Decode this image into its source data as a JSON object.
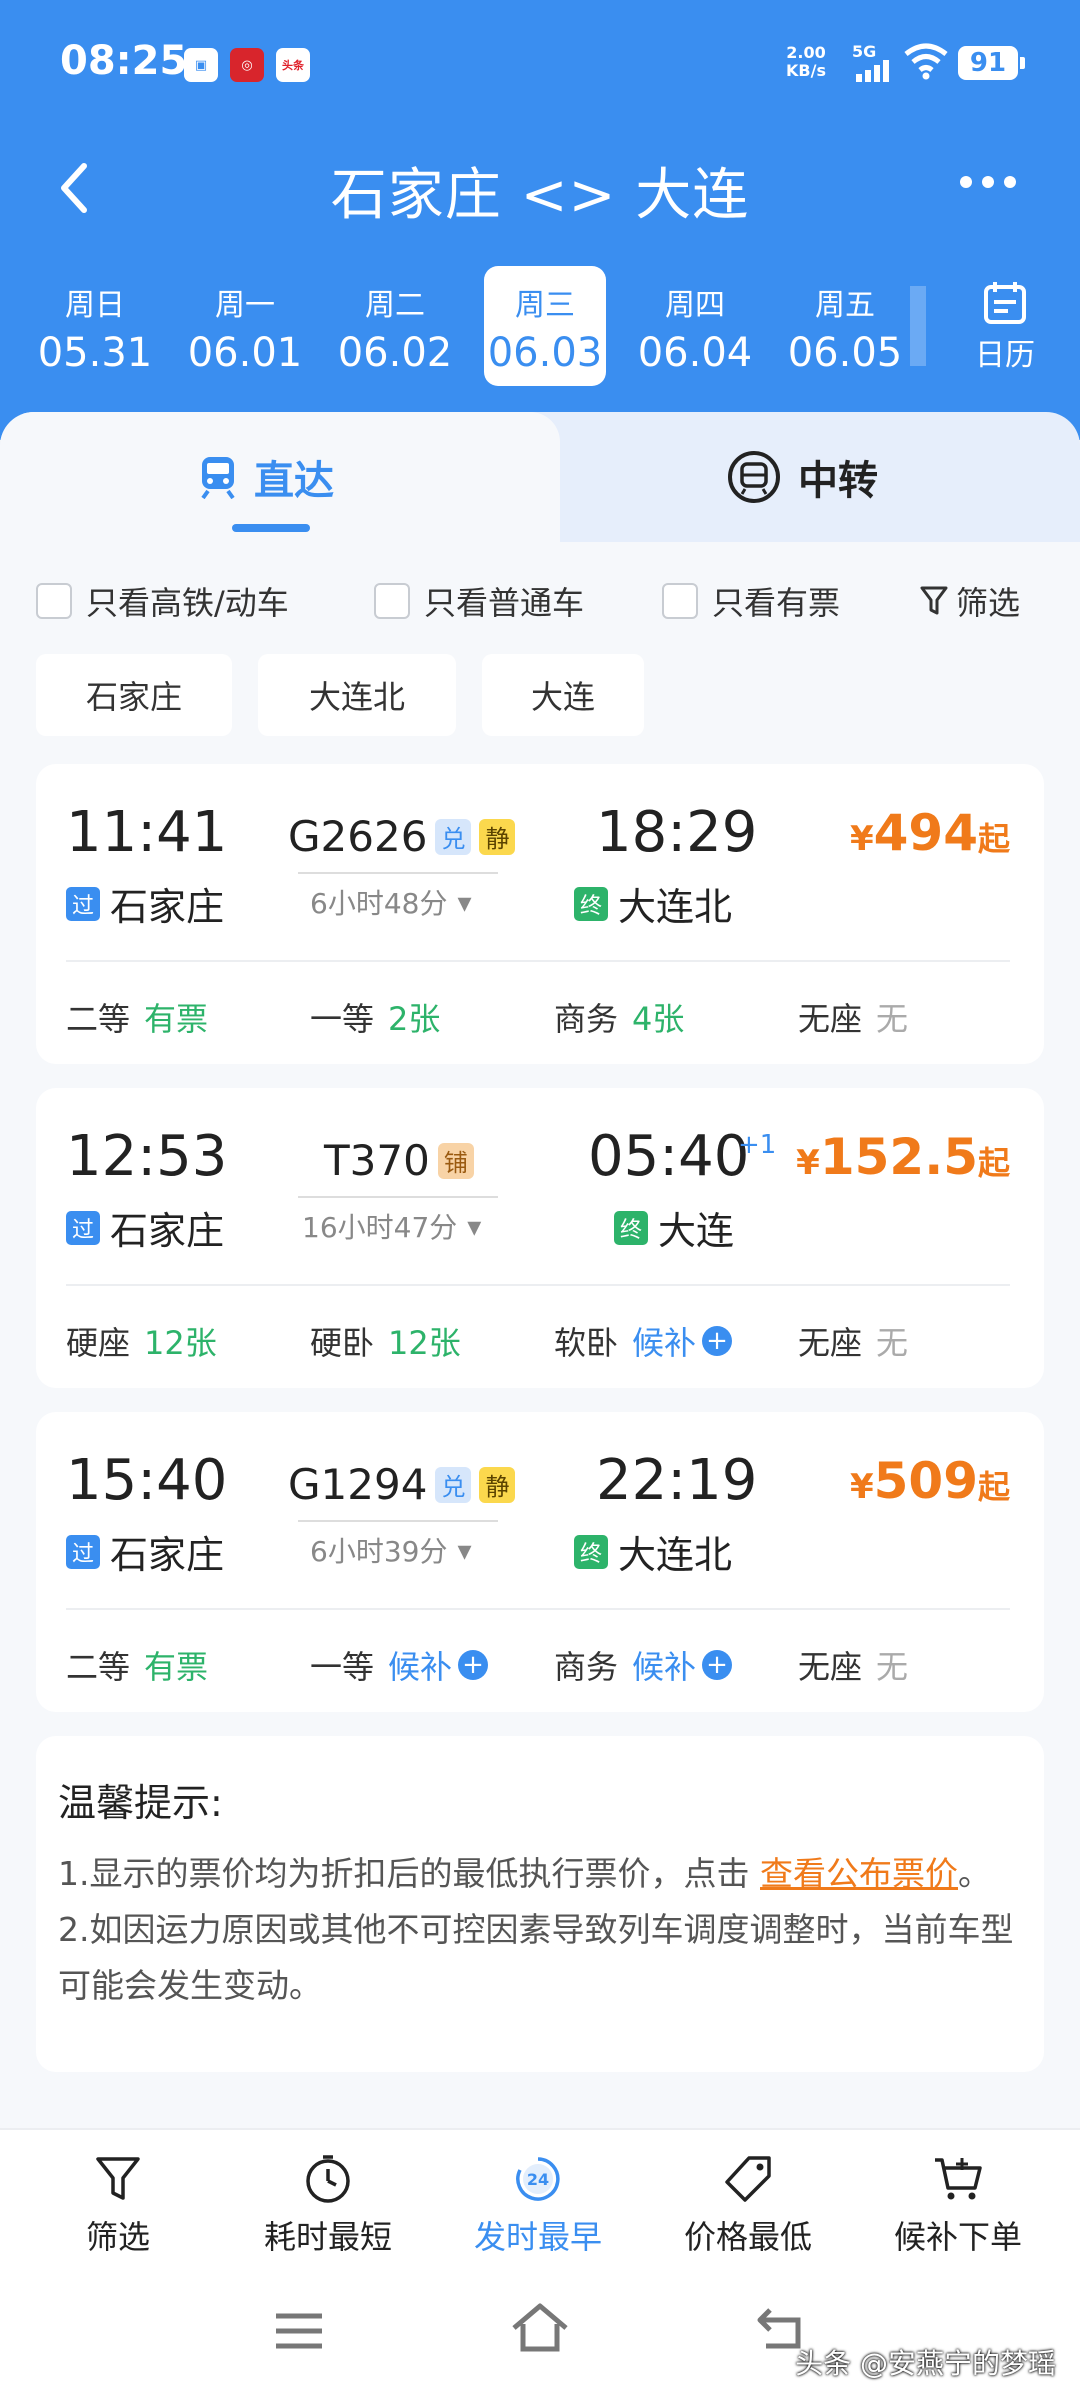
{
  "status": {
    "time": "08:25",
    "speed_value": "2.00",
    "speed_unit": "KB/s",
    "network": "5G",
    "battery": "91",
    "app_icon_3": "头条"
  },
  "header": {
    "title": "石家庄 <> 大连",
    "back_icon": "chevron-left-icon",
    "more_icon": "more-horizontal-icon"
  },
  "dates": [
    {
      "dow": "周日",
      "date": "05.31"
    },
    {
      "dow": "周一",
      "date": "06.01"
    },
    {
      "dow": "周二",
      "date": "06.02"
    },
    {
      "dow": "周三",
      "date": "06.03"
    },
    {
      "dow": "周四",
      "date": "06.04"
    },
    {
      "dow": "周五",
      "date": "06.05"
    }
  ],
  "selected_date_index": 3,
  "calendar_label": "日历",
  "tabs": {
    "direct": "直达",
    "transfer": "中转"
  },
  "filters": {
    "high_speed": "只看高铁/动车",
    "normal": "只看普通车",
    "available": "只看有票",
    "filter": "筛选"
  },
  "stations": [
    "石家庄",
    "大连北",
    "大连"
  ],
  "trains": [
    {
      "dep_time": "11:41",
      "dep_tag": "过",
      "dep_station": "石家庄",
      "train_no": "G2626",
      "badges": [
        "兑",
        "静"
      ],
      "duration": "6小时48分",
      "arr_time": "18:29",
      "arr_plus": "",
      "arr_tag": "终",
      "arr_station": "大连北",
      "price_symbol": "¥",
      "price": "494",
      "price_suffix": "起",
      "seats": [
        {
          "name": "二等",
          "status": "有票"
        },
        {
          "name": "一等",
          "status": "2张"
        },
        {
          "name": "商务",
          "status": "4张"
        },
        {
          "name": "无座",
          "status": "无"
        }
      ]
    },
    {
      "dep_time": "12:53",
      "dep_tag": "过",
      "dep_station": "石家庄",
      "train_no": "T370",
      "badges": [
        "铺"
      ],
      "duration": "16小时47分",
      "arr_time": "05:40",
      "arr_plus": "+1",
      "arr_tag": "终",
      "arr_station": "大连",
      "price_symbol": "¥",
      "price": "152.5",
      "price_suffix": "起",
      "seats": [
        {
          "name": "硬座",
          "status": "12张"
        },
        {
          "name": "硬卧",
          "status": "12张"
        },
        {
          "name": "软卧",
          "status": "候补"
        },
        {
          "name": "无座",
          "status": "无"
        }
      ]
    },
    {
      "dep_time": "15:40",
      "dep_tag": "过",
      "dep_station": "石家庄",
      "train_no": "G1294",
      "badges": [
        "兑",
        "静"
      ],
      "duration": "6小时39分",
      "arr_time": "22:19",
      "arr_plus": "",
      "arr_tag": "终",
      "arr_station": "大连北",
      "price_symbol": "¥",
      "price": "509",
      "price_suffix": "起",
      "seats": [
        {
          "name": "二等",
          "status": "有票"
        },
        {
          "name": "一等",
          "status": "候补"
        },
        {
          "name": "商务",
          "status": "候补"
        },
        {
          "name": "无座",
          "status": "无"
        }
      ]
    }
  ],
  "notice": {
    "title": "温馨提示:",
    "line1_prefix": "1.显示的票价均为折扣后的最低执行票价，点击",
    "line1_link": "查看公布票价",
    "line1_suffix": "。",
    "line2": "2.如因运力原因或其他不可控因素导致列车调度调整时，当前车型可能会发生变动。"
  },
  "bottom_bar": [
    {
      "label": "筛选",
      "icon": "filter-icon"
    },
    {
      "label": "耗时最短",
      "icon": "stopwatch-icon"
    },
    {
      "label": "发时最早",
      "icon": "24-clock-icon",
      "active": true
    },
    {
      "label": "价格最低",
      "icon": "price-tag-icon"
    },
    {
      "label": "候补下单",
      "icon": "cart-plus-icon"
    }
  ],
  "watermark": "头条 @安燕宁的梦瑶",
  "colors": {
    "brand_blue": "#3a8ef0",
    "price_orange": "#f07a1a",
    "available_green": "#2db36a"
  }
}
